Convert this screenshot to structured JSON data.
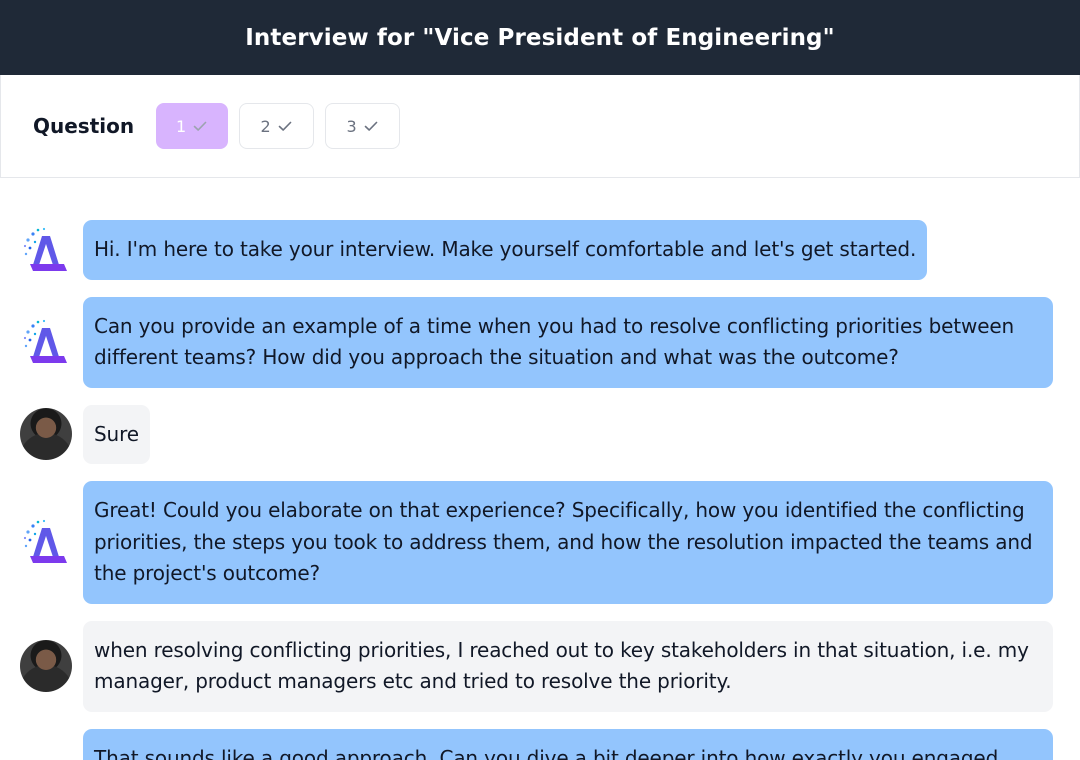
{
  "header": {
    "title": "Interview for \"Vice President of Engineering\""
  },
  "questions": {
    "label": "Question",
    "items": [
      {
        "number": "1",
        "state": "active"
      },
      {
        "number": "2",
        "state": "done"
      },
      {
        "number": "3",
        "state": "done"
      }
    ]
  },
  "messages": [
    {
      "sender": "ai",
      "text": "Hi. I'm here to take your interview. Make yourself comfortable and let's get started."
    },
    {
      "sender": "ai",
      "text": "Can you provide an example of a time when you had to resolve conflicting priorities between different teams? How did you approach the situation and what was the outcome?"
    },
    {
      "sender": "user",
      "text": "Sure"
    },
    {
      "sender": "ai",
      "text": "Great! Could you elaborate on that experience? Specifically, how you identified the conflicting priorities, the steps you took to address them, and how the resolution impacted the teams and the project's outcome?"
    },
    {
      "sender": "user",
      "text": "when resolving conflicting priorities, I reached out to key stakeholders in that situation, i.e. my manager, product managers etc and tried to resolve the priority."
    },
    {
      "sender": "ai",
      "text": "That sounds like a good approach. Can you dive a bit deeper into how exactly you engaged"
    }
  ],
  "colors": {
    "header_bg": "#1f2937",
    "ai_bubble": "#93c5fd",
    "user_bubble": "#f3f4f6",
    "active_question": "#d8b4fe"
  },
  "icons": {
    "ai_avatar": "ai-logo-icon",
    "user_avatar": "user-avatar",
    "check": "check-icon"
  }
}
